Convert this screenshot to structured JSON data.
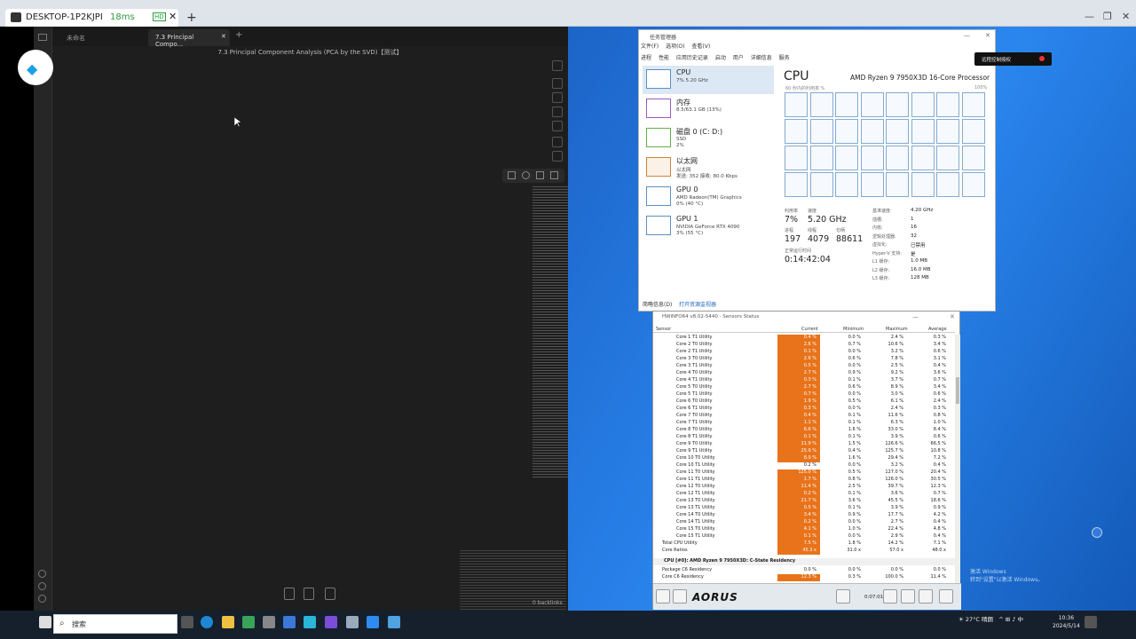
{
  "remote": {
    "tab_title": "DESKTOP-1P2KJPI",
    "latency": "18ms",
    "hd": "HD",
    "close": "✕",
    "plus": "+",
    "minimize": "—",
    "restore": "❐",
    "close_win": "✕"
  },
  "obsidian": {
    "tabs": [
      {
        "label": "未命名"
      },
      {
        "label": "7.3 Principal Compo..."
      }
    ],
    "tab_close": "✕",
    "new_tab": "+",
    "note_title": "7.3 Principal Component Analysis (PCA by the SVD)【测试】",
    "backlinks": "0 backlinks"
  },
  "taskmgr": {
    "title": "任务管理器",
    "menu": [
      "文件(F)",
      "选项(O)",
      "查看(V)"
    ],
    "tabs": [
      "进程",
      "性能",
      "应用历史记录",
      "启动",
      "用户",
      "详细信息",
      "服务"
    ],
    "sidebar": [
      {
        "name": "CPU",
        "lines": [
          "7% 5.20 GHz"
        ]
      },
      {
        "name": "内存",
        "lines": [
          "8.5/63.1 GB (13%)"
        ]
      },
      {
        "name": "磁盘 0 (C: D:)",
        "lines": [
          "SSD",
          "2%"
        ]
      },
      {
        "name": "以太网",
        "lines": [
          "以太网",
          "发送: 352 接收: 80.0 Kbps"
        ]
      },
      {
        "name": "GPU 0",
        "lines": [
          "AMD Radeon(TM) Graphics",
          "0% (40 °C)"
        ]
      },
      {
        "name": "GPU 1",
        "lines": [
          "NVIDIA GeForce RTX 4090",
          "3% (55 °C)"
        ]
      }
    ],
    "main_title": "CPU",
    "model": "AMD Ryzen 9 7950X3D 16-Core Processor",
    "axis_left": "60 秒内的利用率 %",
    "axis_right": "100%",
    "stats": {
      "util_label": "利用率",
      "util": "7%",
      "speed_label": "速度",
      "speed": "5.20 GHz",
      "proc_label": "进程",
      "proc": "197",
      "thread_label": "线程",
      "thread": "4079",
      "handle_label": "句柄",
      "handle": "88611",
      "uptime_label": "正常运行时间",
      "uptime": "0:14:42:04"
    },
    "specs": [
      {
        "k": "基准速度:",
        "v": "4.20 GHz"
      },
      {
        "k": "插槽:",
        "v": "1"
      },
      {
        "k": "内核:",
        "v": "16"
      },
      {
        "k": "逻辑处理器:",
        "v": "32"
      },
      {
        "k": "虚拟化:",
        "v": "已禁用"
      },
      {
        "k": "Hyper-V 支持:",
        "v": "是"
      },
      {
        "k": "L1 缓存:",
        "v": "1.0 MB"
      },
      {
        "k": "L2 缓存:",
        "v": "16.0 MB"
      },
      {
        "k": "L3 缓存:",
        "v": "128 MB"
      }
    ],
    "footer_brief": "简略信息(D)",
    "footer_link": "打开资源监视器"
  },
  "rc_badge": "远程控制授权",
  "hwinfo": {
    "title": "HWiNFO64 v8.02-5440 - Sensors Status",
    "headers": [
      "Sensor",
      "Current",
      "Minimum",
      "Maximum",
      "Average"
    ],
    "rows": [
      {
        "name": "Core 1 T1 Utility",
        "cur": "0.4 %",
        "min": "0.0 %",
        "max": "2.4 %",
        "avg": "0.3 %"
      },
      {
        "name": "Core 2 T0 Utility",
        "cur": "2.6 %",
        "min": "0.7 %",
        "max": "10.6 %",
        "avg": "3.4 %"
      },
      {
        "name": "Core 2 T1 Utility",
        "cur": "0.1 %",
        "min": "0.0 %",
        "max": "3.2 %",
        "avg": "0.6 %"
      },
      {
        "name": "Core 3 T0 Utility",
        "cur": "2.6 %",
        "min": "0.6 %",
        "max": "7.8 %",
        "avg": "3.1 %"
      },
      {
        "name": "Core 3 T1 Utility",
        "cur": "0.5 %",
        "min": "0.0 %",
        "max": "2.5 %",
        "avg": "0.4 %"
      },
      {
        "name": "Core 4 T0 Utility",
        "cur": "2.7 %",
        "min": "0.9 %",
        "max": "9.2 %",
        "avg": "3.6 %"
      },
      {
        "name": "Core 4 T1 Utility",
        "cur": "0.3 %",
        "min": "0.1 %",
        "max": "3.7 %",
        "avg": "0.7 %"
      },
      {
        "name": "Core 5 T0 Utility",
        "cur": "2.7 %",
        "min": "0.6 %",
        "max": "8.9 %",
        "avg": "3.4 %"
      },
      {
        "name": "Core 5 T1 Utility",
        "cur": "0.7 %",
        "min": "0.0 %",
        "max": "3.0 %",
        "avg": "0.6 %"
      },
      {
        "name": "Core 6 T0 Utility",
        "cur": "1.9 %",
        "min": "0.5 %",
        "max": "6.1 %",
        "avg": "2.4 %"
      },
      {
        "name": "Core 6 T1 Utility",
        "cur": "0.3 %",
        "min": "0.0 %",
        "max": "2.4 %",
        "avg": "0.3 %"
      },
      {
        "name": "Core 7 T0 Utility",
        "cur": "0.4 %",
        "min": "0.1 %",
        "max": "11.6 %",
        "avg": "0.8 %"
      },
      {
        "name": "Core 7 T1 Utility",
        "cur": "1.1 %",
        "min": "0.1 %",
        "max": "6.3 %",
        "avg": "1.0 %"
      },
      {
        "name": "Core 8 T0 Utility",
        "cur": "6.6 %",
        "min": "1.6 %",
        "max": "33.0 %",
        "avg": "8.4 %"
      },
      {
        "name": "Core 8 T1 Utility",
        "cur": "0.1 %",
        "min": "0.1 %",
        "max": "3.9 %",
        "avg": "0.6 %"
      },
      {
        "name": "Core 9 T0 Utility",
        "cur": "11.9 %",
        "min": "1.5 %",
        "max": "126.6 %",
        "avg": "66.5 %"
      },
      {
        "name": "Core 9 T1 Utility",
        "cur": "25.9 %",
        "min": "0.4 %",
        "max": "125.7 %",
        "avg": "10.8 %"
      },
      {
        "name": "Core 10 T0 Utility",
        "cur": "8.0 %",
        "min": "1.6 %",
        "max": "29.4 %",
        "avg": "7.2 %"
      },
      {
        "name": "Core 10 T1 Utility",
        "cur": "0.2 %",
        "min": "0.0 %",
        "max": "3.2 %",
        "avg": "0.4 %",
        "plain": true
      },
      {
        "name": "Core 11 T0 Utility",
        "cur": "125.0 %",
        "min": "0.5 %",
        "max": "127.0 %",
        "avg": "20.4 %"
      },
      {
        "name": "Core 11 T1 Utility",
        "cur": "1.7 %",
        "min": "0.8 %",
        "max": "126.0 %",
        "avg": "30.5 %"
      },
      {
        "name": "Core 12 T0 Utility",
        "cur": "11.4 %",
        "min": "2.5 %",
        "max": "39.7 %",
        "avg": "12.3 %"
      },
      {
        "name": "Core 12 T1 Utility",
        "cur": "0.2 %",
        "min": "0.1 %",
        "max": "3.6 %",
        "avg": "0.7 %"
      },
      {
        "name": "Core 13 T0 Utility",
        "cur": "21.7 %",
        "min": "3.6 %",
        "max": "45.5 %",
        "avg": "18.6 %"
      },
      {
        "name": "Core 13 T1 Utility",
        "cur": "0.5 %",
        "min": "0.1 %",
        "max": "3.9 %",
        "avg": "0.9 %"
      },
      {
        "name": "Core 14 T0 Utility",
        "cur": "3.4 %",
        "min": "0.9 %",
        "max": "17.7 %",
        "avg": "4.2 %"
      },
      {
        "name": "Core 14 T1 Utility",
        "cur": "0.2 %",
        "min": "0.0 %",
        "max": "2.7 %",
        "avg": "0.4 %"
      },
      {
        "name": "Core 15 T0 Utility",
        "cur": "4.1 %",
        "min": "1.0 %",
        "max": "22.4 %",
        "avg": "4.8 %"
      },
      {
        "name": "Core 15 T1 Utility",
        "cur": "0.1 %",
        "min": "0.0 %",
        "max": "2.9 %",
        "avg": "0.4 %"
      },
      {
        "name": "Total CPU Utility",
        "cur": "7.5 %",
        "min": "1.8 %",
        "max": "14.2 %",
        "avg": "7.1 %"
      },
      {
        "name": "Core Ratios",
        "cur": "45.3 x",
        "min": "31.0 x",
        "max": "57.0 x",
        "avg": "48.0 x"
      }
    ],
    "section": "CPU [#0]: AMD Ryzen 9 7950X3D: C-State Residency",
    "section_rows": [
      {
        "name": "Package C6 Residency",
        "cur": "0.0 %",
        "min": "0.0 %",
        "max": "0.0 %",
        "avg": "0.0 %",
        "plain": true
      },
      {
        "name": "Core C6 Residency",
        "cur": "12.3 %",
        "min": "0.3 %",
        "max": "100.0 %",
        "avg": "11.4 %"
      }
    ],
    "logo": "AORUS",
    "time": "0:07:01"
  },
  "desktop": {
    "activate_line1": "激活 Windows",
    "activate_line2": "转到\"设置\"以激活 Windows。"
  },
  "taskbar": {
    "search_placeholder": "搜索",
    "weather": "27°C 晴朗",
    "ime": "中",
    "time": "10:36",
    "date": "2024/5/14"
  },
  "colors": {
    "hw_highlight": "#e8731b",
    "desktop": "#1b6fd3",
    "taskbar": "#16202c"
  }
}
